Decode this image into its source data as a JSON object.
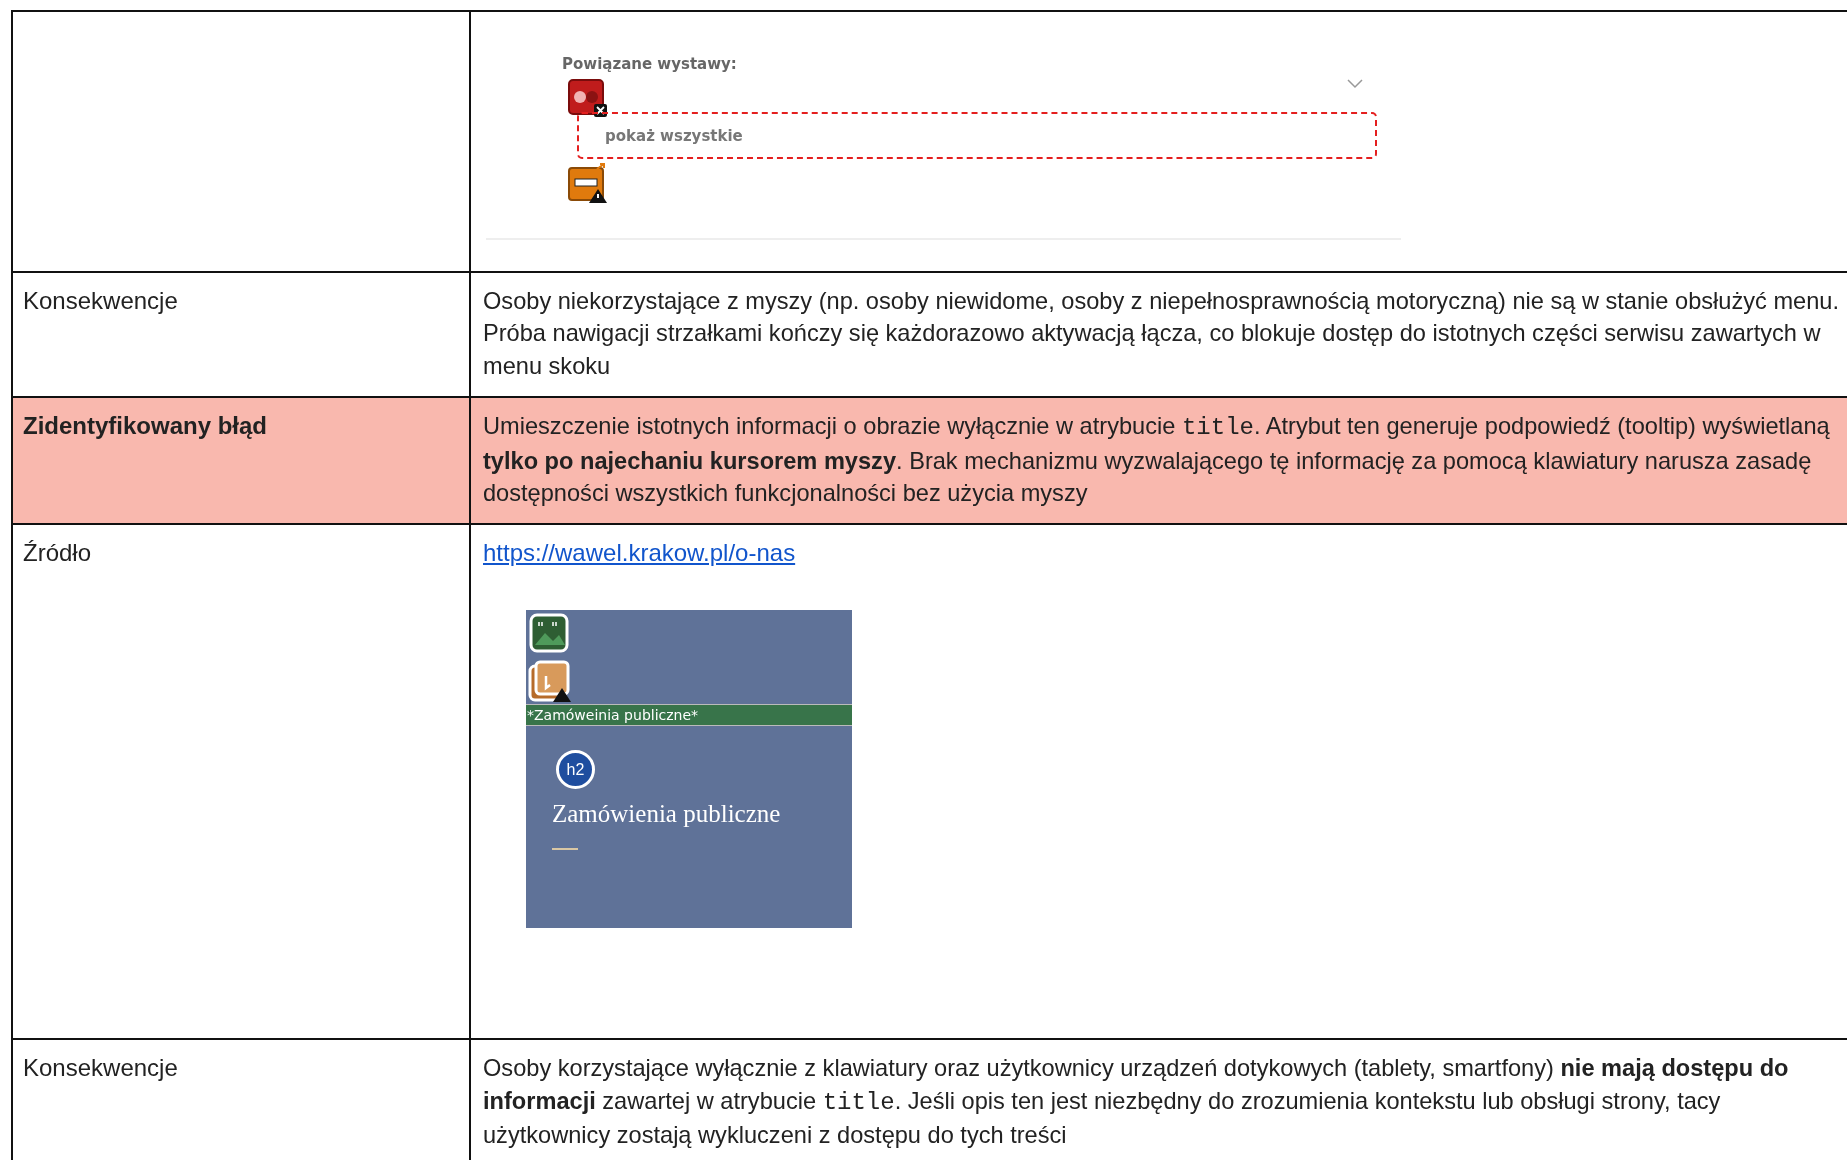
{
  "table": {
    "rows": [
      {
        "kind": "exhibit-figure",
        "highlighted": false,
        "figure": {
          "title": "Powiązane wystawy:",
          "button": "pokaż wszystkie"
        }
      },
      {
        "kind": "text",
        "highlighted": false,
        "label": "Konsekwencje",
        "paragraph": [
          {
            "kind": "plain",
            "text": "Osoby niekorzystające z myszy (np. osoby niewidome, osoby z niepełnosprawnością motoryczną) nie są w stanie obsłużyć menu. Próba nawigacji strzałkami kończy się każdorazowo aktywacją łącza, co blokuje dostęp do istotnych części serwisu zawartych w menu skoku"
          }
        ]
      },
      {
        "kind": "text",
        "highlighted": true,
        "label": "Zidentyfikowany błąd",
        "paragraph": [
          {
            "kind": "plain",
            "text": "Umieszczenie istotnych informacji o obrazie wyłącznie w atrybucie "
          },
          {
            "kind": "code",
            "text": "title"
          },
          {
            "kind": "plain",
            "text": ". Atrybut ten generuje podpowiedź (tooltip) wyświetlaną "
          },
          {
            "kind": "bold",
            "text": "tylko po najechaniu kursorem myszy"
          },
          {
            "kind": "plain",
            "text": ". Brak mechanizmu wyzwalającego tę informację za pomocą klawiatury narusza zasadę dostępności wszystkich funkcjonalności bez użycia myszy"
          }
        ]
      },
      {
        "kind": "source",
        "highlighted": false,
        "label": "Źródło",
        "link": "https://wawel.krakow.pl/o-nas",
        "figure": {
          "bar_text": "*Zamóweinia publiczne*",
          "badge": "h2",
          "heading": "Zamówienia publiczne"
        }
      },
      {
        "kind": "text",
        "highlighted": false,
        "label": "Konsekwencje",
        "paragraph": [
          {
            "kind": "plain",
            "text": "Osoby korzystające wyłącznie z klawiatury oraz użytkownicy urządzeń dotykowych (tablety, smartfony) "
          },
          {
            "kind": "bold",
            "text": "nie mają dostępu do informacji"
          },
          {
            "kind": "plain",
            "text": " zawartej w atrybucie "
          },
          {
            "kind": "code",
            "text": "title"
          },
          {
            "kind": "plain",
            "text": ". Jeśli opis ten jest niezbędny do zrozumienia kontekstu lub obsługi strony, tacy użytkownicy zostają wykluczeni z dostępu do tych treści"
          }
        ]
      }
    ]
  }
}
